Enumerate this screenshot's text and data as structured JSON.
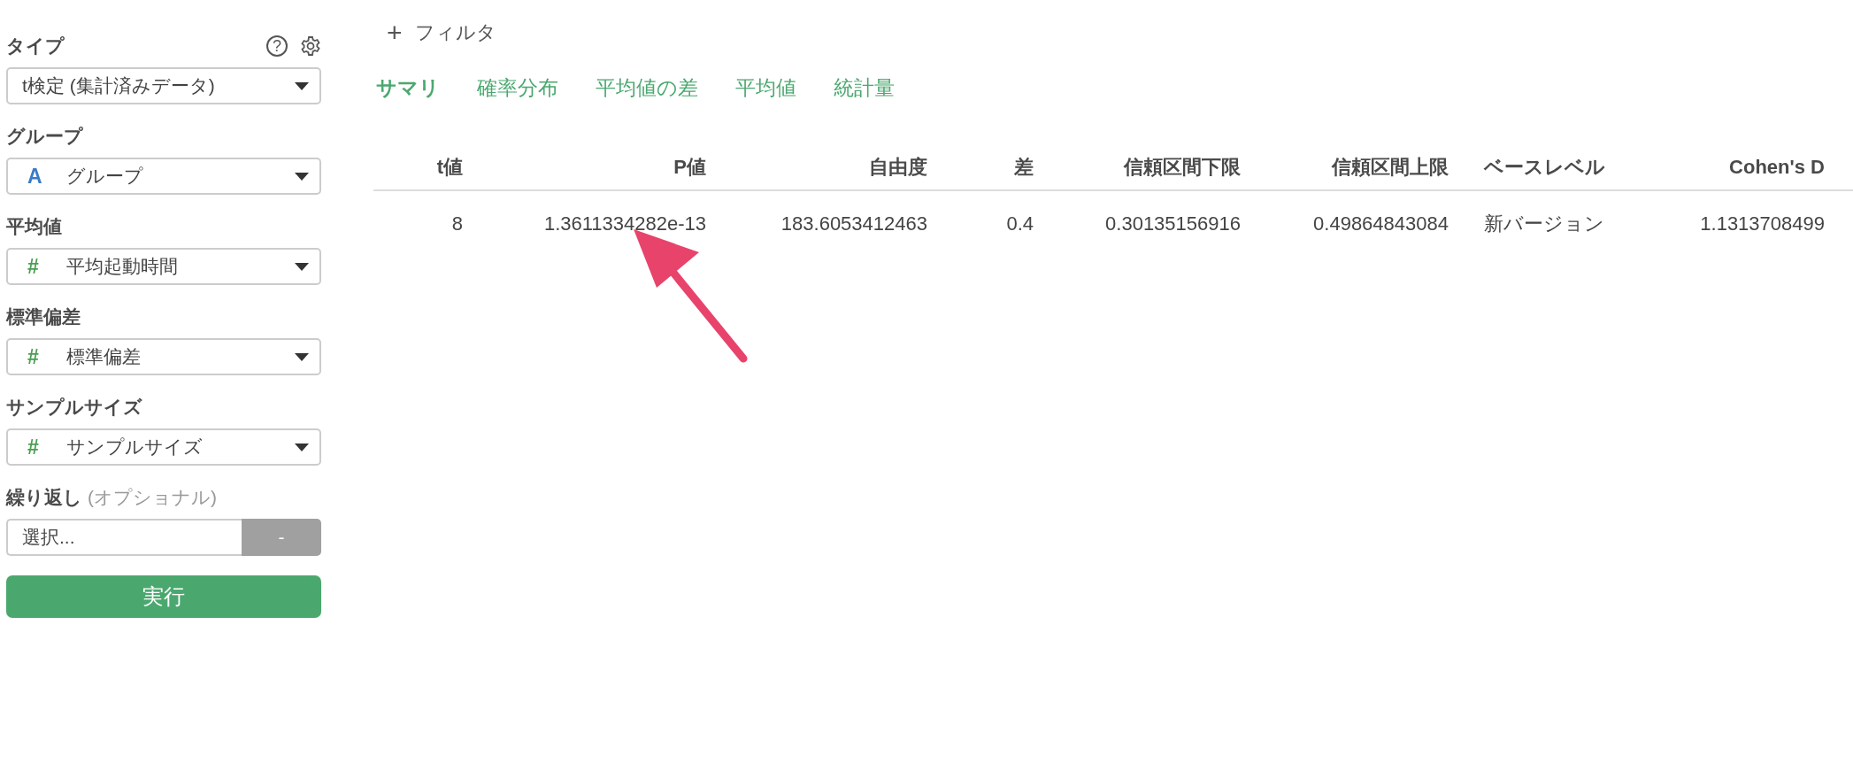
{
  "sidebar": {
    "help_icon": "?",
    "fields": [
      {
        "label": "タイプ",
        "kind": "select",
        "value": "t検定 (集計済みデータ)"
      },
      {
        "label": "グループ",
        "kind": "select",
        "type_icon": {
          "text": "A",
          "kind": "category"
        },
        "value": "グループ"
      },
      {
        "label": "平均値",
        "kind": "select",
        "type_icon": {
          "text": "#",
          "kind": "number"
        },
        "value": "平均起動時間"
      },
      {
        "label": "標準偏差",
        "kind": "select",
        "type_icon": {
          "text": "#",
          "kind": "number"
        },
        "value": "標準偏差"
      },
      {
        "label": "サンプルサイズ",
        "kind": "select",
        "type_icon": {
          "text": "#",
          "kind": "number"
        },
        "value": "サンプルサイズ"
      },
      {
        "label": "繰り返し",
        "hint": "(オプショナル)",
        "kind": "picker",
        "placeholder": "選択...",
        "button": "-"
      }
    ],
    "run_button": "実行"
  },
  "filter": {
    "icon": "+",
    "label": "フィルタ"
  },
  "tabs": [
    {
      "label": "サマリ",
      "selected": true
    },
    {
      "label": "確率分布",
      "selected": false
    },
    {
      "label": "平均値の差",
      "selected": false
    },
    {
      "label": "平均値",
      "selected": false
    },
    {
      "label": "統計量",
      "selected": false
    }
  ],
  "table": {
    "columns": [
      {
        "label": "t値",
        "kind": "number"
      },
      {
        "label": "P値",
        "kind": "number"
      },
      {
        "label": "自由度",
        "kind": "number"
      },
      {
        "label": "差",
        "kind": "number"
      },
      {
        "label": "信頼区間下限",
        "kind": "number"
      },
      {
        "label": "信頼区間上限",
        "kind": "number"
      },
      {
        "label": "ベースレベル",
        "kind": "text"
      },
      {
        "label": "Cohen's D",
        "kind": "number"
      }
    ],
    "rows": [
      [
        "8",
        "1.3611334282e-13",
        "183.6053412463",
        "0.4",
        "0.30135156916",
        "0.49864843084",
        "新バージョン",
        "1.1313708499"
      ]
    ]
  }
}
